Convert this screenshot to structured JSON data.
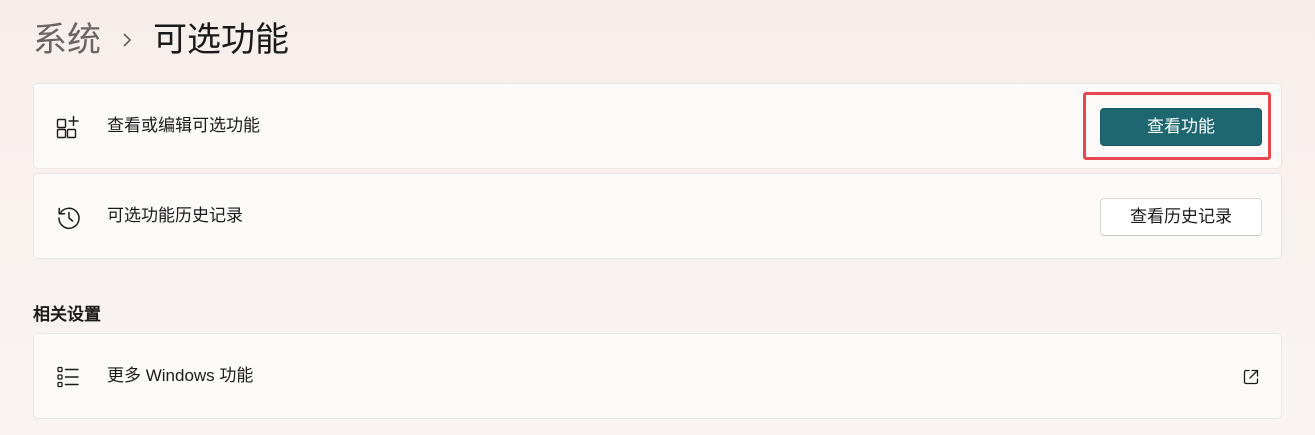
{
  "breadcrumb": {
    "parent": "系统",
    "current": "可选功能"
  },
  "cards": [
    {
      "icon": "add-apps-icon",
      "label": "查看或编辑可选功能",
      "button_label": "查看功能"
    },
    {
      "icon": "history-icon",
      "label": "可选功能历史记录",
      "button_label": "查看历史记录"
    }
  ],
  "related": {
    "title": "相关设置",
    "items": [
      {
        "icon": "list-icon",
        "label": "更多 Windows 功能",
        "action_icon": "external-link-icon"
      }
    ]
  },
  "colors": {
    "accent": "#1e6670",
    "highlight": "#e8474f"
  }
}
